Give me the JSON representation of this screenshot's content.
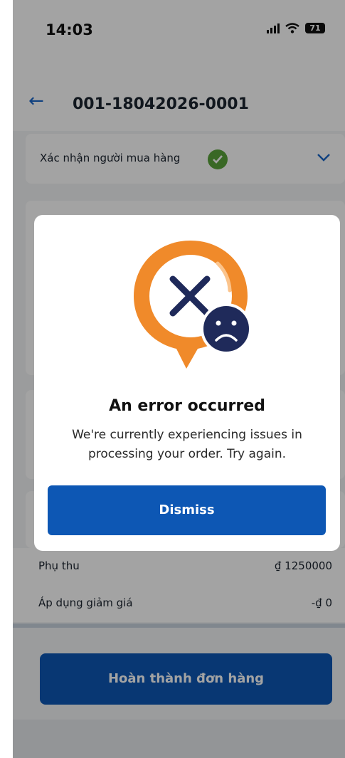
{
  "status_bar": {
    "time": "14:03",
    "battery": "71"
  },
  "header": {
    "title": "001-18042026-0001"
  },
  "buyer_section": {
    "label": "Xác nhận người mua hàng"
  },
  "rows": [
    {
      "label": "Phụ thu",
      "value": "₫ 1250000"
    },
    {
      "label": "Áp dụng giảm giá",
      "value": "-₫ 0"
    }
  ],
  "footer": {
    "complete_label": "Hoàn thành đơn hàng"
  },
  "modal": {
    "title": "An error occurred",
    "message": "We're currently experiencing issues in processing your order. Try again.",
    "dismiss_label": "Dismiss"
  },
  "colors": {
    "primary": "#0d57b4",
    "accent_orange": "#f08a2a",
    "navy": "#1f2a5a",
    "success": "#5aa33a"
  },
  "icons": [
    "back-arrow-icon",
    "check-circle-icon",
    "chevron-down-icon",
    "error-x-icon",
    "sad-face-icon"
  ]
}
